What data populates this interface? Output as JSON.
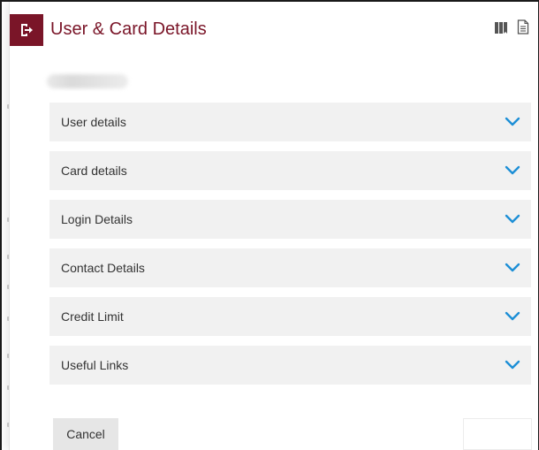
{
  "panel": {
    "title": "User & Card Details",
    "accent_color": "#7a1528"
  },
  "header_icons": [
    "exit-icon",
    "book-icon",
    "document-icon"
  ],
  "sections": [
    {
      "label": "User details"
    },
    {
      "label": "Card details"
    },
    {
      "label": "Login Details"
    },
    {
      "label": "Contact Details"
    },
    {
      "label": "Credit Limit"
    },
    {
      "label": "Useful Links"
    }
  ],
  "section_chevron_color": "#1d8fd6",
  "footer": {
    "cancel_label": "Cancel"
  }
}
